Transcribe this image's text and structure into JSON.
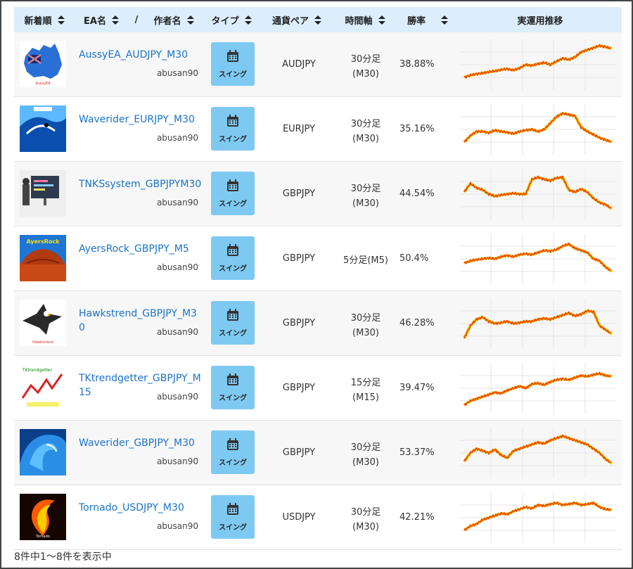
{
  "header": {
    "newest": "新着順",
    "ea_name": "EA名",
    "slash": "/",
    "author": "作者名",
    "type": "タイプ",
    "pair": "通貨ペア",
    "timeframe": "時間軸",
    "win_rate": "勝率",
    "trend": "実運用推移"
  },
  "colors": {
    "header_bg": "#dceefb",
    "link": "#1a73c9",
    "type_button": "#7ec9f2",
    "chart_line": "#e64a0a",
    "chart_fill": "#f6c400"
  },
  "rows": [
    {
      "name": "AussyEA_AUDJPY_M30",
      "author": "abusan90",
      "type": "スイング",
      "pair": "AUDJPY",
      "tf1": "30分足",
      "tf2": "(M30)",
      "win": "38.88%",
      "thumb": "australia-map",
      "trend": [
        0.2,
        0.25,
        0.28,
        0.3,
        0.33,
        0.35,
        0.38,
        0.4,
        0.37,
        0.42,
        0.5,
        0.48,
        0.52,
        0.55,
        0.5,
        0.58,
        0.65,
        0.62,
        0.68,
        0.8,
        0.85,
        0.9,
        0.95,
        0.92,
        0.88
      ]
    },
    {
      "name": "Waverider_EURJPY_M30",
      "author": "abusan90",
      "type": "スイング",
      "pair": "EURJPY",
      "tf1": "30分足",
      "tf2": "(M30)",
      "win": "35.16%",
      "thumb": "ocean-wave-surfer",
      "trend": [
        0.2,
        0.35,
        0.45,
        0.45,
        0.42,
        0.48,
        0.45,
        0.43,
        0.4,
        0.45,
        0.48,
        0.5,
        0.45,
        0.5,
        0.65,
        0.8,
        0.88,
        0.85,
        0.82,
        0.55,
        0.45,
        0.38,
        0.3,
        0.25,
        0.2
      ]
    },
    {
      "name": "TNKSsystem_GBPJPYM30",
      "author": "abusan90",
      "type": "スイング",
      "pair": "GBPJPY",
      "tf1": "30分足",
      "tf2": "(M30)",
      "win": "44.54%",
      "thumb": "trading-monitor",
      "trend": [
        0.55,
        0.75,
        0.65,
        0.6,
        0.5,
        0.45,
        0.48,
        0.5,
        0.52,
        0.5,
        0.5,
        0.85,
        0.9,
        0.85,
        0.82,
        0.88,
        0.9,
        0.6,
        0.55,
        0.62,
        0.55,
        0.4,
        0.3,
        0.25,
        0.15
      ]
    },
    {
      "name": "AyersRock_GBPJPY_M5",
      "author": "abusan90",
      "type": "スイング",
      "pair": "GBPJPY",
      "tf1": "5分足(M5)",
      "tf2": "",
      "win": "50.4%",
      "thumb": "ayers-rock",
      "trend": [
        0.4,
        0.45,
        0.48,
        0.5,
        0.52,
        0.5,
        0.55,
        0.58,
        0.55,
        0.6,
        0.62,
        0.6,
        0.65,
        0.7,
        0.68,
        0.72,
        0.8,
        0.85,
        0.75,
        0.7,
        0.65,
        0.5,
        0.45,
        0.3,
        0.2
      ]
    },
    {
      "name": "Hawkstrend_GBPJPY_M30",
      "author": "abusan90",
      "type": "スイング",
      "pair": "GBPJPY",
      "tf1": "30分足",
      "tf2": "(M30)",
      "win": "46.28%",
      "thumb": "eagle",
      "trend": [
        0.15,
        0.45,
        0.6,
        0.65,
        0.55,
        0.5,
        0.52,
        0.55,
        0.5,
        0.52,
        0.55,
        0.55,
        0.6,
        0.62,
        0.6,
        0.65,
        0.7,
        0.75,
        0.68,
        0.72,
        0.8,
        0.78,
        0.45,
        0.35,
        0.25
      ]
    },
    {
      "name": "TKtrendgetter_GBPJPY_M15",
      "author": "abusan90",
      "type": "スイング",
      "pair": "GBPJPY",
      "tf1": "15分足",
      "tf2": "(M15)",
      "win": "39.47%",
      "thumb": "trend-chart-sign",
      "trend": [
        0.1,
        0.2,
        0.25,
        0.3,
        0.35,
        0.4,
        0.38,
        0.45,
        0.5,
        0.55,
        0.5,
        0.6,
        0.62,
        0.58,
        0.65,
        0.7,
        0.72,
        0.7,
        0.75,
        0.8,
        0.78,
        0.82,
        0.85,
        0.8,
        0.78
      ]
    },
    {
      "name": "Waverider_GBPJPY_M30",
      "author": "abusan90",
      "type": "スイング",
      "pair": "GBPJPY",
      "tf1": "30分足",
      "tf2": "(M30)",
      "win": "53.37%",
      "thumb": "blue-wave",
      "trend": [
        0.3,
        0.5,
        0.6,
        0.55,
        0.5,
        0.58,
        0.45,
        0.38,
        0.55,
        0.6,
        0.65,
        0.7,
        0.75,
        0.72,
        0.8,
        0.85,
        0.9,
        0.85,
        0.8,
        0.75,
        0.7,
        0.6,
        0.5,
        0.35,
        0.25
      ]
    },
    {
      "name": "Tornado_USDJPY_M30",
      "author": "abusan90",
      "type": "スイング",
      "pair": "USDJPY",
      "tf1": "30分足",
      "tf2": "(M30)",
      "win": "42.21%",
      "thumb": "fire-tornado",
      "trend": [
        0.2,
        0.3,
        0.35,
        0.45,
        0.5,
        0.55,
        0.6,
        0.58,
        0.65,
        0.7,
        0.75,
        0.72,
        0.8,
        0.78,
        0.82,
        0.85,
        0.8,
        0.82,
        0.85,
        0.8,
        0.82,
        0.85,
        0.75,
        0.7,
        0.68
      ]
    }
  ],
  "footer": "8件中1〜8件を表示中"
}
